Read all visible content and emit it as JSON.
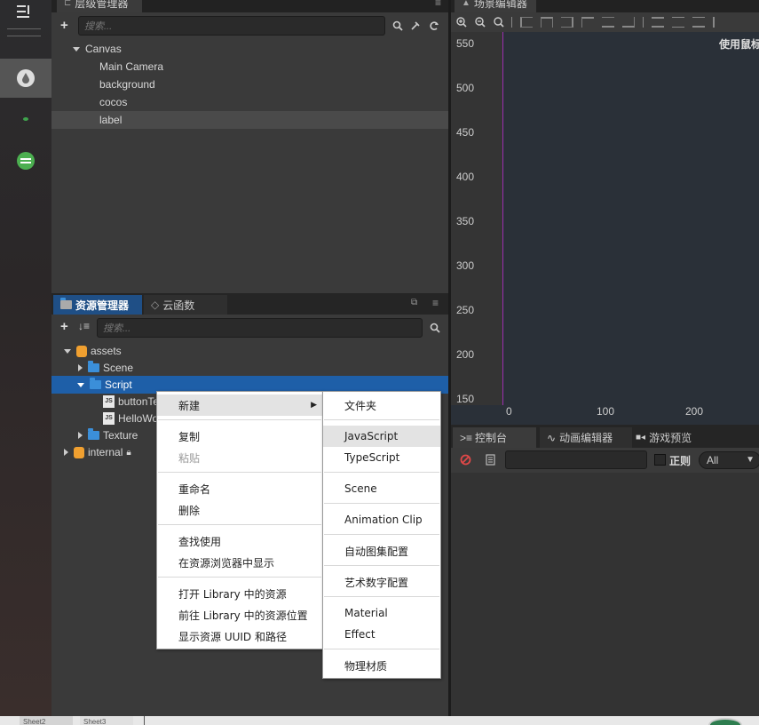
{
  "hierarchy": {
    "title": "层级管理器",
    "search_placeholder": "搜索...",
    "nodes": [
      "Canvas",
      "Main Camera",
      "background",
      "cocos",
      "label"
    ]
  },
  "assets": {
    "tab_assets": "资源管理器",
    "tab_cloud": "云函数",
    "search_placeholder": "搜索...",
    "tree": {
      "assets": "assets",
      "scene": "Scene",
      "script": "Script",
      "file1": "buttonTe",
      "file2": "HelloWo",
      "texture": "Texture",
      "internal": "internal"
    },
    "js_badge": "JS"
  },
  "scene": {
    "title": "场景编辑器",
    "hint": "使用鼠标",
    "y_ticks": [
      "550",
      "500",
      "450",
      "400",
      "350",
      "300",
      "250",
      "200",
      "150"
    ],
    "x_ticks": [
      "0",
      "100",
      "200"
    ]
  },
  "console": {
    "tab_console": "控制台",
    "tab_anim": "动画编辑器",
    "tab_preview": "游戏预览",
    "regex_label": "正则",
    "level_select": "All"
  },
  "context_menu": {
    "new": "新建",
    "copy": "复制",
    "paste": "粘贴",
    "rename": "重命名",
    "delete": "删除",
    "find_usage": "查找使用",
    "show_in_explorer": "在资源浏览器中显示",
    "open_in_library": "打开 Library 中的资源",
    "goto_library": "前往 Library 中的资源位置",
    "show_uuid": "显示资源 UUID 和路径"
  },
  "submenu": {
    "folder": "文件夹",
    "javascript": "JavaScript",
    "typescript": "TypeScript",
    "scene": "Scene",
    "animation_clip": "Animation Clip",
    "auto_atlas": "自动图集配置",
    "label_atlas": "艺术数字配置",
    "material": "Material",
    "effect": "Effect",
    "physics_material": "物理材质"
  },
  "statusbar": {
    "item1": "Sheet2",
    "item2": "Sheet3"
  }
}
